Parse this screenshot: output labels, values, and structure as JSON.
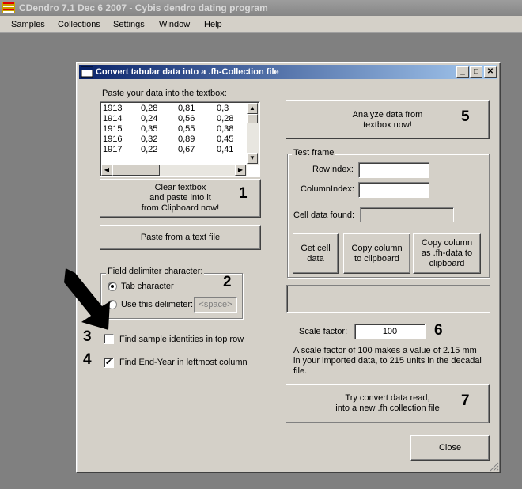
{
  "app": {
    "title": "CDendro 7.1  Dec 6 2007 - Cybis dendro dating program"
  },
  "menu": {
    "items": [
      {
        "label": "Samples",
        "underline": "S"
      },
      {
        "label": "Collections",
        "underline": "C"
      },
      {
        "label": "Settings",
        "underline": "S"
      },
      {
        "label": "Window",
        "underline": "W"
      },
      {
        "label": "Help",
        "underline": "H"
      }
    ]
  },
  "dialog": {
    "title": "Convert tabular data into a .fh-Collection file",
    "title_buttons": {
      "minimize": "_",
      "maximize": "□",
      "close": "✕"
    },
    "paste_label": "Paste your data into the textbox:",
    "data_rows": [
      [
        "1913",
        "0,28",
        "0,81",
        "0,3"
      ],
      [
        "1914",
        "0,24",
        "0,56",
        "0,28"
      ],
      [
        "1915",
        "0,35",
        "0,55",
        "0,38"
      ],
      [
        "1916",
        "0,32",
        "0,89",
        "0,45"
      ],
      [
        "1917",
        "0,22",
        "0,67",
        "0,41"
      ]
    ],
    "clear_paste_button": "Clear textbox\nand paste into it\nfrom Clipboard now!",
    "paste_file_button": "Paste from a text file",
    "delimiter": {
      "legend": "Field delimiter character:",
      "tab_label": "Tab character",
      "tab_selected": true,
      "custom_label": "Use this delimeter:",
      "custom_value": "<space>"
    },
    "find_sample_ids": {
      "label": "Find sample identities in top row",
      "checked": false
    },
    "find_end_year": {
      "label": "Find End-Year in leftmost column",
      "checked": true
    },
    "analyze_button": "Analyze data from\ntextbox now!",
    "test_frame": {
      "legend": "Test frame",
      "row_index_label": "RowIndex:",
      "row_index_value": "",
      "column_index_label": "ColumnIndex:",
      "column_index_value": "",
      "cell_found_label": "Cell data found:",
      "cell_found_value": "",
      "get_cell_button": "Get cell\ndata",
      "copy_column_button": "Copy column\nto clipboard",
      "copy_fh_button": "Copy column\nas .fh-data to\nclipboard"
    },
    "status_text": "",
    "scale_factor_label": "Scale factor:",
    "scale_factor_value": "100",
    "scale_note": "A scale factor of 100 makes a value of 2.15 mm\nin your imported data, to 215 units in the decadal\nfile.",
    "convert_button": "Try convert data read,\ninto a new .fh collection file",
    "close_button": "Close",
    "step_numbers": [
      "1",
      "2",
      "3",
      "4",
      "5",
      "6",
      "7"
    ]
  }
}
